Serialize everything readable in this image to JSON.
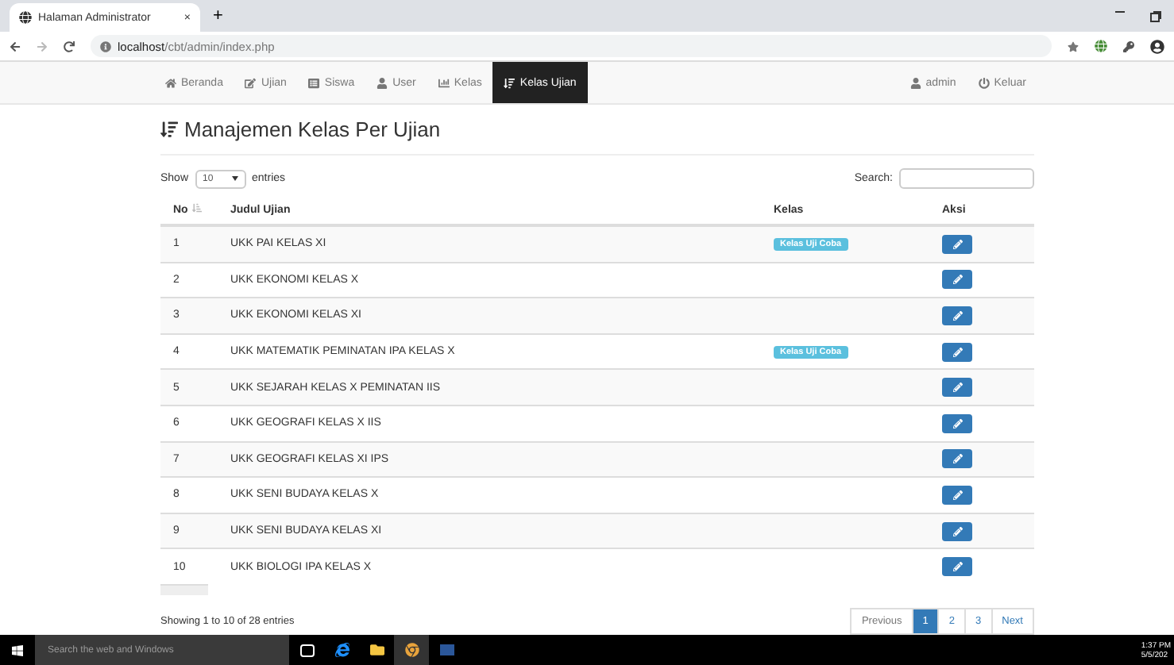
{
  "browser": {
    "tab_title": "Halaman Administrator",
    "tab_close": "×",
    "new_tab": "+",
    "url_host": "localhost",
    "url_path": "/cbt/admin/index.php"
  },
  "navbar": {
    "items": [
      {
        "label": "Beranda",
        "selected": false
      },
      {
        "label": "Ujian",
        "selected": false
      },
      {
        "label": "Siswa",
        "selected": false
      },
      {
        "label": "User",
        "selected": false
      },
      {
        "label": "Kelas",
        "selected": false
      },
      {
        "label": "Kelas Ujian",
        "selected": true
      }
    ],
    "right": [
      {
        "label": "admin"
      },
      {
        "label": "Keluar"
      }
    ]
  },
  "page_title": "Manajemen Kelas Per Ujian",
  "controls": {
    "show_label": "Show",
    "page_size": "10",
    "entries_label": "entries",
    "search_label": "Search:"
  },
  "table": {
    "columns": [
      "No",
      "Judul Ujian",
      "Kelas",
      "Aksi"
    ],
    "rows": [
      {
        "no": "1",
        "judul": "UKK PAI KELAS XI",
        "kelas": "Kelas Uji Coba"
      },
      {
        "no": "2",
        "judul": "UKK EKONOMI KELAS X"
      },
      {
        "no": "3",
        "judul": "UKK EKONOMI KELAS XI"
      },
      {
        "no": "4",
        "judul": "UKK MATEMATIK PEMINATAN IPA KELAS X",
        "kelas": "Kelas Uji Coba"
      },
      {
        "no": "5",
        "judul": "UKK SEJARAH KELAS X PEMINATAN IIS"
      },
      {
        "no": "6",
        "judul": "UKK GEOGRAFI KELAS X IIS"
      },
      {
        "no": "7",
        "judul": "UKK GEOGRAFI KELAS XI IPS"
      },
      {
        "no": "8",
        "judul": "UKK SENI BUDAYA KELAS X"
      },
      {
        "no": "9",
        "judul": "UKK SENI BUDAYA KELAS XI"
      },
      {
        "no": "10",
        "judul": "UKK BIOLOGI IPA KELAS X"
      }
    ]
  },
  "info": "Showing 1 to 10 of 28 entries",
  "pagination": [
    {
      "label": "Previous",
      "selected": false
    },
    {
      "label": "1",
      "selected": true
    },
    {
      "label": "2",
      "selected": false
    },
    {
      "label": "3",
      "selected": false
    },
    {
      "label": "Next",
      "selected": false
    }
  ],
  "taskbar": {
    "search_placeholder": "Search the web and Windows",
    "time": "1:37 PM",
    "date": "5/5/202"
  }
}
